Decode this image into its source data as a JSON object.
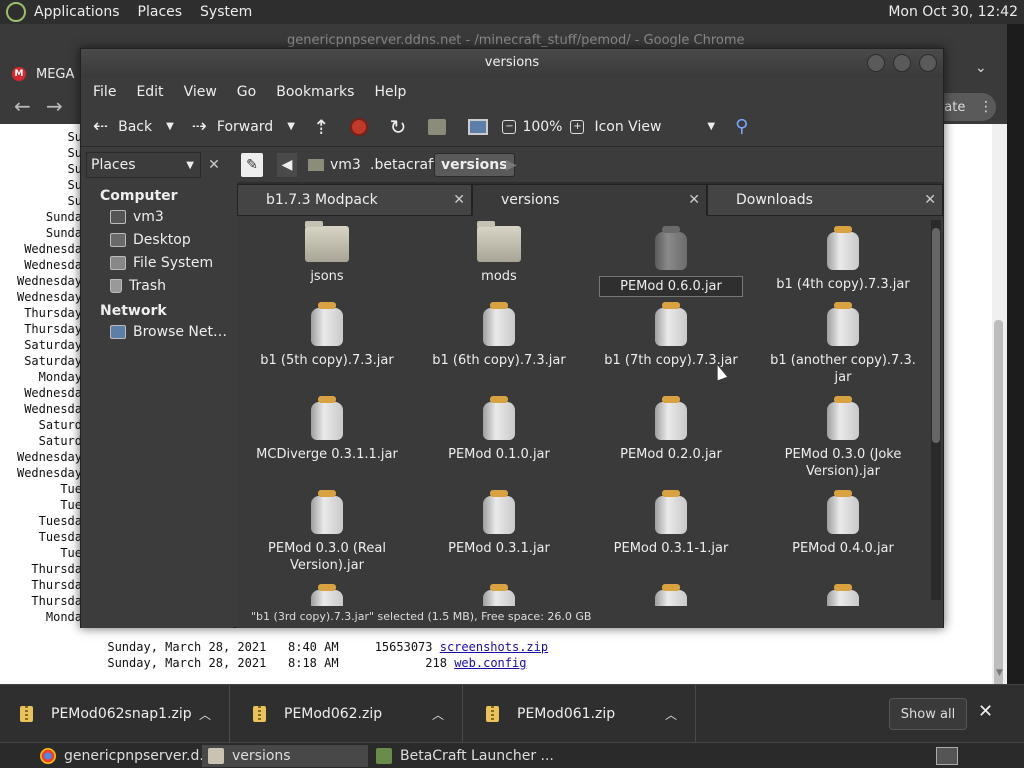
{
  "top_panel": {
    "menus": [
      "Applications",
      "Places",
      "System"
    ],
    "clock": "Mon Oct 30, 12:42"
  },
  "chrome": {
    "title": "genericpnpserver.ddns.net - /minecraft_stuff/pemod/ - Google Chrome",
    "tab_label": "MEGA",
    "update_label": "date",
    "listing": {
      "left_rows": [
        "Su",
        "Su",
        "Su",
        "Su",
        "Su",
        "Sunda",
        "Sunda",
        "Wednesda",
        "Wednesda",
        "Wednesday",
        "Wednesday",
        "Thursday",
        "Thursday",
        "Saturday",
        "Saturday",
        "Monday",
        "Wednesda",
        "Wednesda",
        "Saturd",
        "Saturd",
        "Wednesday",
        "Wednesday",
        "Tue",
        "Tue",
        "Tuesda",
        "Tuesda",
        "Tue",
        "Thursda",
        "Thursda",
        "Thursda",
        "Monda"
      ],
      "full_rows": [
        {
          "date": "Sunday, March 28, 2021",
          "time": "8:40 AM",
          "size": "15653073",
          "name": "screenshots.zip"
        },
        {
          "date": "Sunday, March 28, 2021",
          "time": "8:18 AM",
          "size": "218",
          "name": "web.config"
        }
      ]
    }
  },
  "file_manager": {
    "title": "versions",
    "menu": [
      "File",
      "Edit",
      "View",
      "Go",
      "Bookmarks",
      "Help"
    ],
    "toolbar": {
      "back": "Back",
      "forward": "Forward",
      "zoom": "100%",
      "view_mode": "Icon View"
    },
    "places_label": "Places",
    "breadcrumbs": [
      "vm3",
      ".betacraft",
      "versions"
    ],
    "sidebar": {
      "computer_label": "Computer",
      "computer_items": [
        "vm3",
        "Desktop",
        "File System",
        "Trash"
      ],
      "network_label": "Network",
      "network_items": [
        "Browse Net…"
      ]
    },
    "tabs": [
      "b1.7.3 Modpack",
      "versions",
      "Downloads"
    ],
    "items": [
      {
        "name": "jsons",
        "type": "folder"
      },
      {
        "name": "mods",
        "type": "folder"
      },
      {
        "name": "PEMod 0.6.0.jar",
        "type": "jar-renaming"
      },
      {
        "name": "b1 (4th copy).7.3.jar",
        "type": "jar"
      },
      {
        "name": "b1 (5th copy).7.3.jar",
        "type": "jar"
      },
      {
        "name": "b1 (6th copy).7.3.jar",
        "type": "jar"
      },
      {
        "name": "b1 (7th copy).7.3.jar",
        "type": "jar"
      },
      {
        "name": "b1 (another copy).7.3.\njar",
        "type": "jar"
      },
      {
        "name": "MCDiverge 0.3.1.1.jar",
        "type": "jar"
      },
      {
        "name": "PEMod 0.1.0.jar",
        "type": "jar"
      },
      {
        "name": "PEMod 0.2.0.jar",
        "type": "jar"
      },
      {
        "name": "PEMod 0.3.0 (Joke\nVersion).jar",
        "type": "jar"
      },
      {
        "name": "PEMod 0.3.0 (Real\nVersion).jar",
        "type": "jar"
      },
      {
        "name": "PEMod 0.3.1.jar",
        "type": "jar"
      },
      {
        "name": "PEMod 0.3.1-1.jar",
        "type": "jar"
      },
      {
        "name": "PEMod 0.4.0.jar",
        "type": "jar"
      }
    ],
    "status": "\"b1 (3rd copy).7.3.jar\" selected (1.5 MB), Free space: 26.0 GB"
  },
  "downloads_bar": {
    "items": [
      "PEMod062snap1.zip",
      "PEMod062.zip",
      "PEMod061.zip"
    ],
    "show_all": "Show all"
  },
  "taskbar": {
    "items": [
      "genericpnpserver.d...",
      "versions",
      "BetaCraft Launcher ..."
    ]
  }
}
